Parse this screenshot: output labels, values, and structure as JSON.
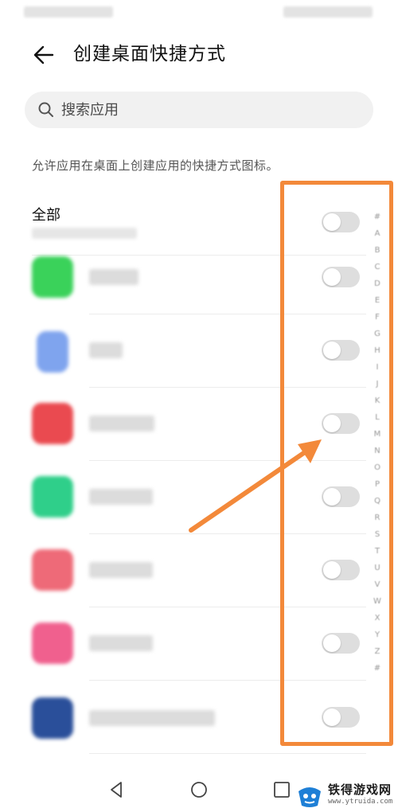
{
  "header": {
    "title": "创建桌面快捷方式"
  },
  "search": {
    "placeholder": "搜索应用",
    "value": ""
  },
  "description": "允许应用在桌面上创建应用的快捷方式图标。",
  "all_toggle": {
    "label": "全部",
    "enabled": false
  },
  "apps": [
    {
      "name": "",
      "enabled": false,
      "icon_color": "#3ad25a"
    },
    {
      "name": "",
      "enabled": false,
      "icon_color": "#7fa4ee"
    },
    {
      "name": "",
      "enabled": false,
      "icon_color": "#ea4a50"
    },
    {
      "name": "",
      "enabled": false,
      "icon_color": "#2fcf8a"
    },
    {
      "name": "",
      "enabled": false,
      "icon_color": "#ee6a78"
    },
    {
      "name": "",
      "enabled": false,
      "icon_color": "#f0608e"
    },
    {
      "name": "",
      "enabled": false,
      "icon_color": "#2a4f9a"
    }
  ],
  "index_bar": [
    "#",
    "A",
    "B",
    "C",
    "D",
    "E",
    "F",
    "G",
    "H",
    "I",
    "J",
    "K",
    "L",
    "M",
    "N",
    "O",
    "P",
    "Q",
    "R",
    "S",
    "T",
    "U",
    "V",
    "W",
    "X",
    "Y",
    "Z",
    "#"
  ],
  "annotation": {
    "box_color": "#f3893a",
    "arrow_color": "#f3893a"
  },
  "watermark": {
    "title": "铁得游戏网",
    "url": "www.ytruida.com"
  }
}
